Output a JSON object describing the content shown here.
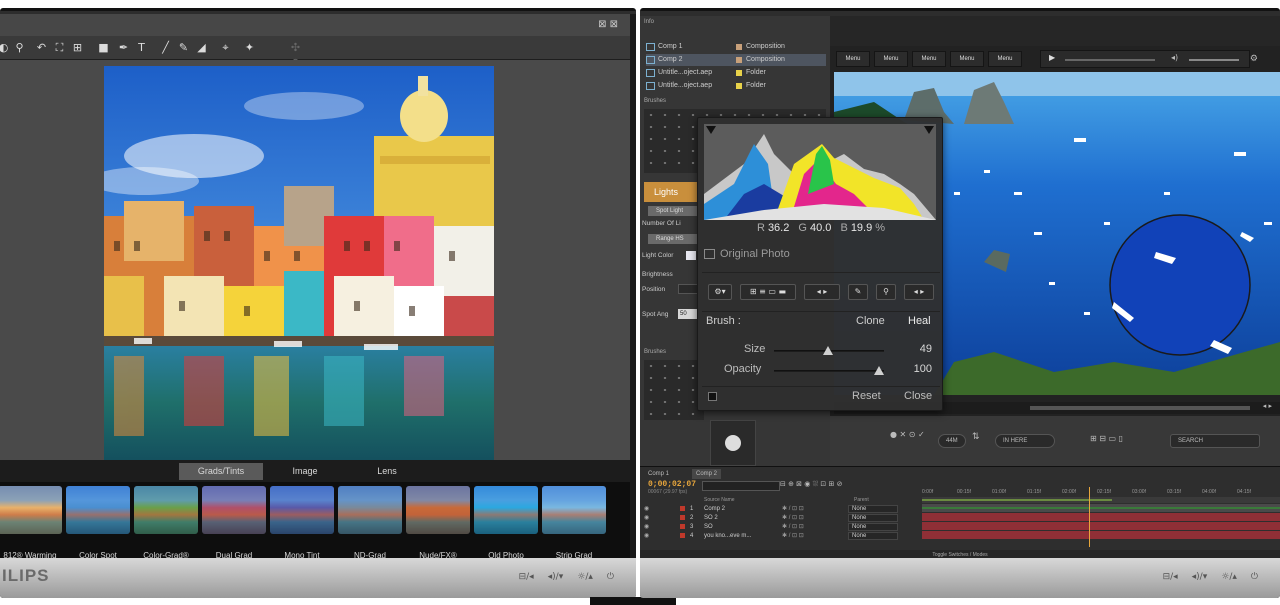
{
  "left_app": {
    "view_tabs": [
      "Grads/Tints",
      "Image",
      "Lens"
    ],
    "active_view_tab": "Grads/Tints",
    "presets": [
      {
        "label": "812® Warming"
      },
      {
        "label": "Color Spot"
      },
      {
        "label": "Color-Grad®"
      },
      {
        "label": "Dual Grad"
      },
      {
        "label": "Mono Tint"
      },
      {
        "label": "ND-Grad"
      },
      {
        "label": "Nude/FX®"
      },
      {
        "label": "Old Photo"
      },
      {
        "label": "Strip Grad"
      }
    ],
    "brand": "ILIPS"
  },
  "right_app": {
    "project_panel_tab": "Info",
    "project_items": [
      {
        "name": "Comp 1",
        "type": "Composition",
        "color": "#c8a07a"
      },
      {
        "name": "Comp 2",
        "type": "Composition",
        "color": "#c8a07a",
        "selected": true
      },
      {
        "name": "Untitle...oject.aep",
        "type": "Folder",
        "color": "#e8d24a"
      },
      {
        "name": "Untitle...oject.aep",
        "type": "Folder",
        "color": "#e8d24a"
      }
    ],
    "brushes_tab": "Brushes",
    "brushes_tab_2": "Brushes",
    "lights_tab": "Lights",
    "side_controls": {
      "spot_light": "Spot Light",
      "number_of_lights": "Number Of Li",
      "range": "Range HS",
      "light_color": "Light Color",
      "brightness": "Brightness",
      "position": "Position",
      "spot_angle": "Spot Ang",
      "spot_angle_value": "50"
    },
    "menu_buttons": [
      "Menu",
      "Menu",
      "Menu",
      "Menu",
      "Menu"
    ],
    "controls": {
      "in_here": "IN HERE",
      "search": "SEARCH",
      "zoom": "44M"
    },
    "timeline": {
      "tabs": [
        "Comp 1",
        "Comp 2"
      ],
      "active_tab": "Comp 2",
      "timecode": "0;00;02;07",
      "timecode_sub": "00067 (29.97 fps)",
      "header_source": "Source Name",
      "header_parent": "Parent",
      "layers": [
        {
          "num": "1",
          "name": "Comp 2",
          "parent": "None"
        },
        {
          "num": "2",
          "name": "SO 2",
          "parent": "None"
        },
        {
          "num": "3",
          "name": "SO",
          "parent": "None"
        },
        {
          "num": "4",
          "name": "you kno...eve m...",
          "parent": "None"
        }
      ],
      "ruler_ticks": [
        "0:00f",
        "00:15f",
        "01:00f",
        "01:15f",
        "02:00f",
        "02:15f",
        "03:00f",
        "03:15f",
        "04:00f",
        "04:15f"
      ],
      "footer": "Toggle Switches / Modes"
    }
  },
  "hud": {
    "readout": {
      "r_label": "R",
      "r": "36.2",
      "g_label": "G",
      "g": "40.0",
      "b_label": "B",
      "b": "19.9",
      "unit": "%"
    },
    "original_photo": "Original Photo",
    "brush_label": "Brush :",
    "clone": "Clone",
    "heal": "Heal",
    "size_label": "Size",
    "size_value": "49",
    "size_fraction": 0.49,
    "opacity_label": "Opacity",
    "opacity_value": "100",
    "opacity_fraction": 0.95,
    "reset": "Reset",
    "close": "Close"
  }
}
